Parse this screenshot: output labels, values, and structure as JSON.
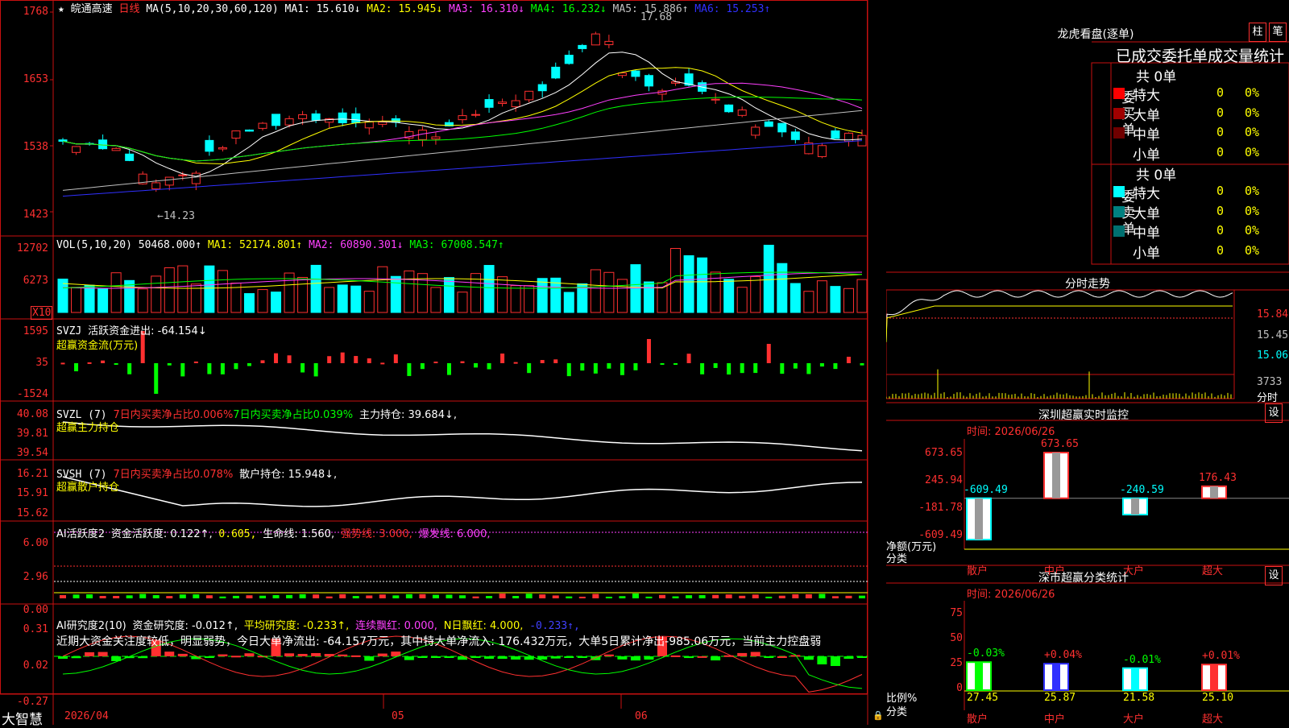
{
  "header": {
    "stock_name": "皖通高速",
    "period": "日线",
    "ma_params": "MA(5,10,20,30,60,120)",
    "ma": [
      {
        "label": "MA1: 15.610↓",
        "color": "#ffffff"
      },
      {
        "label": "MA2: 15.945↓",
        "color": "#ffff00"
      },
      {
        "label": "MA3: 16.310↓",
        "color": "#ff40ff"
      },
      {
        "label": "MA4: 16.232↓",
        "color": "#00ff00"
      },
      {
        "label": "MA5: 15.886↑",
        "color": "#c0c0c0"
      },
      {
        "label": "MA6: 15.253↑",
        "color": "#3030ff"
      }
    ],
    "high_mark": "17.68",
    "low_mark": "←14.23"
  },
  "price_axis": [
    "1768",
    "1653",
    "1538",
    "1423"
  ],
  "vol_panel": {
    "title": "VOL(5,10,20)",
    "value": "50468.000↑",
    "ma1": "MA1: 52174.801↑",
    "ma2": "MA2: 60890.301↓",
    "ma3": "MA3: 67008.547↑",
    "axis": [
      "12702",
      "6273"
    ],
    "unit": "X10"
  },
  "svzj_panel": {
    "title": "SVZJ",
    "label": "活跃资金进出: -64.154↓",
    "subtitle": "超赢资金流(万元)",
    "axis": [
      "1595",
      "35",
      "-1524"
    ]
  },
  "svzl_panel": {
    "title": "SVZL (7)",
    "red_text": "7日内买卖净占比0.006%",
    "green_text": "7日内买卖净占比0.039%",
    "label": "主力持仓: 39.684↓,",
    "subtitle": "超赢主力持仓",
    "axis": [
      "40.08",
      "39.81",
      "39.54"
    ]
  },
  "svsh_panel": {
    "title": "SVSH (7)",
    "red_text": "7日内买卖净占比0.078%",
    "label": "散户持仓: 15.948↓,",
    "subtitle": "超赢散户持仓",
    "axis": [
      "16.21",
      "15.91",
      "15.62"
    ]
  },
  "ai_active_panel": {
    "title": "AI活跃度2",
    "label1": "资金活跃度: 0.122↑,",
    "label2": "0.605,",
    "label3": "生命线: 1.560,",
    "label4": "强势线: 3.000,",
    "label5": "爆发线: 6.000,",
    "axis": [
      "6.00",
      "2.96",
      "0.00"
    ]
  },
  "ai_research_panel": {
    "title": "AI研究度2(10)",
    "label1": "资金研究度: -0.012↑,",
    "label2": "平均研究度: -0.233↑,",
    "label3": "连续飘红: 0.000,",
    "label4": "N日飘红: 4.000,",
    "label5": "-0.233↑,",
    "summary": "近期大资金关注度较低，明显弱势，今日大单净流出: -64.157万元，其中特大单净流入: 176.432万元，大单5日累计净出-985.06万元，当前主力控盘弱",
    "axis": [
      "0.31",
      "0.02",
      "-0.27"
    ]
  },
  "footer": {
    "brand": "大智慧",
    "dates": [
      "2026/04",
      "05",
      "06"
    ]
  },
  "right_panel": {
    "title": "龙虎看盘(逐单)",
    "btn_bar": "柱",
    "btn_pen": "笔",
    "tabs": "已成交委托单成交量统计",
    "buy": {
      "side_label": "委买单",
      "total": "共 0单",
      "rows": [
        {
          "name": "特大",
          "count": "0",
          "pct": "0%",
          "color": "#ff0000"
        },
        {
          "name": "大单",
          "count": "0",
          "pct": "0%",
          "color": "#a00000"
        },
        {
          "name": "中单",
          "count": "0",
          "pct": "0%",
          "color": "#700000"
        },
        {
          "name": "小单",
          "count": "0",
          "pct": "0%",
          "color": ""
        }
      ]
    },
    "sell": {
      "side_label": "委卖单",
      "total": "共 0单",
      "rows": [
        {
          "name": "特大",
          "count": "0",
          "pct": "0%",
          "color": "#00ffff"
        },
        {
          "name": "大单",
          "count": "0",
          "pct": "0%",
          "color": "#008080"
        },
        {
          "name": "中单",
          "count": "0",
          "pct": "0%",
          "color": "#007070"
        },
        {
          "name": "小单",
          "count": "0",
          "pct": "0%",
          "color": ""
        }
      ]
    },
    "intraday": {
      "title": "分时走势",
      "axis": [
        "15.84",
        "15.45",
        "15.06",
        "3733"
      ],
      "unit": "分时"
    },
    "sz_monitor": {
      "title": "深圳超赢实时监控",
      "btn": "设",
      "time": "时间: 2026/06/26",
      "axis": [
        "673.65",
        "245.94",
        "-181.78",
        "-609.49"
      ],
      "left_label1": "净额(万元)",
      "left_label2": "分类",
      "bars": [
        {
          "cat": "散户",
          "value": -609.49,
          "label": "-609.49",
          "color": "#00ffff"
        },
        {
          "cat": "中户",
          "value": 673.65,
          "label": "673.65",
          "color": "#ff3030"
        },
        {
          "cat": "大户",
          "value": -240.59,
          "label": "-240.59",
          "color": "#00ffff"
        },
        {
          "cat": "超大",
          "value": 176.43,
          "label": "176.43",
          "color": "#ff3030"
        }
      ]
    },
    "sz_classify": {
      "title": "深市超赢分类统计",
      "btn": "设",
      "time": "时间: 2026/06/26",
      "axis": [
        "75",
        "50",
        "25",
        "0"
      ],
      "left_label1": "比例%",
      "left_label2": "分类",
      "bars": [
        {
          "cat": "散户",
          "value": 27.45,
          "label": "27.45",
          "chg": "-0.03%",
          "color": "#00ff00"
        },
        {
          "cat": "中户",
          "value": 25.87,
          "label": "25.87",
          "chg": "+0.04%",
          "color": "#3030ff"
        },
        {
          "cat": "大户",
          "value": 21.58,
          "label": "21.58",
          "chg": "-0.01%",
          "color": "#00ffff"
        },
        {
          "cat": "超大",
          "value": 25.1,
          "label": "25.10",
          "chg": "+0.01%",
          "color": "#ff3030"
        }
      ]
    }
  }
}
